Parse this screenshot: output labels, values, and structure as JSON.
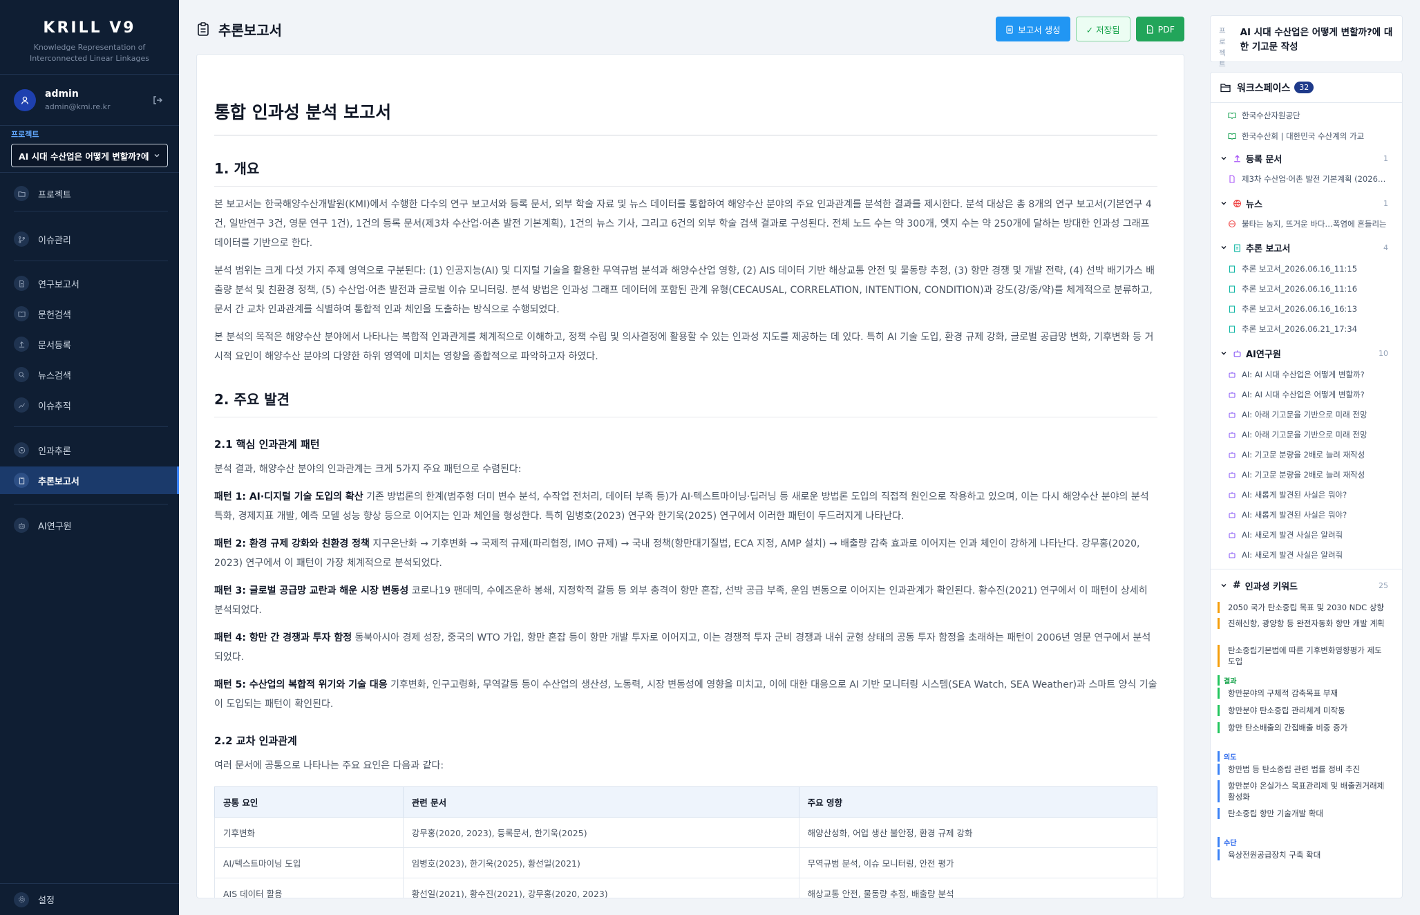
{
  "app": {
    "title": "KRILL V9",
    "subtitle_line1": "Knowledge Representation of",
    "subtitle_line2": "Interconnected Linear Linkages"
  },
  "user": {
    "name": "admin",
    "email": "admin@kmi.re.kr"
  },
  "project": {
    "label": "프로젝트",
    "selected": "AI 시대 수산업은 어떻게 변할까?에"
  },
  "nav": {
    "project": "프로젝트",
    "issues": "이슈관리",
    "reports": "연구보고서",
    "literature": "문헌검색",
    "register": "문서등록",
    "news": "뉴스검색",
    "tracking": "이슈추적",
    "inference": "인과추론",
    "inference_report": "추론보고서",
    "ai_research": "AI연구원",
    "settings": "설정"
  },
  "header": {
    "title": "추론보고서",
    "generate": "보고서 생성",
    "saved": "✓ 저장됨",
    "pdf": "PDF"
  },
  "doc": {
    "title": "통합 인과성 분석 보고서",
    "s1": "1. 개요",
    "p1": "본 보고서는 한국해양수산개발원(KMI)에서 수행한 다수의 연구 보고서와 등록 문서, 외부 학술 자료 및 뉴스 데이터를 통합하여 해양수산 분야의 주요 인과관계를 분석한 결과를 제시한다. 분석 대상은 총 8개의 연구 보고서(기본연구 4건, 일반연구 3건, 영문 연구 1건), 1건의 등록 문서(제3차 수산업·어촌 발전 기본계획), 1건의 뉴스 기사, 그리고 6건의 외부 학술 검색 결과로 구성된다. 전체 노드 수는 약 300개, 엣지 수는 약 250개에 달하는 방대한 인과성 그래프 데이터를 기반으로 한다.",
    "p2": "분석 범위는 크게 다섯 가지 주제 영역으로 구분된다: (1) 인공지능(AI) 및 디지털 기술을 활용한 무역규범 분석과 해양수산업 영향, (2) AIS 데이터 기반 해상교통 안전 및 물동량 추정, (3) 항만 경쟁 및 개발 전략, (4) 선박 배기가스 배출량 분석 및 친환경 정책, (5) 수산업·어촌 발전과 글로벌 이슈 모니터링. 분석 방법은 인과성 그래프 데이터에 포함된 관계 유형(CECAUSAL, CORRELATION, INTENTION, CONDITION)과 강도(강/중/약)를 체계적으로 분류하고, 문서 간 교차 인과관계를 식별하여 통합적 인과 체인을 도출하는 방식으로 수행되었다.",
    "p3": "본 분석의 목적은 해양수산 분야에서 나타나는 복합적 인과관계를 체계적으로 이해하고, 정책 수립 및 의사결정에 활용할 수 있는 인과성 지도를 제공하는 데 있다. 특히 AI 기술 도입, 환경 규제 강화, 글로벌 공급망 변화, 기후변화 등 거시적 요인이 해양수산 분야의 다양한 하위 영역에 미치는 영향을 종합적으로 파악하고자 하였다.",
    "s2": "2. 주요 발견",
    "s21": "2.1 핵심 인과관계 패턴",
    "p4": "분석 결과, 해양수산 분야의 인과관계는 크게 5가지 주요 패턴으로 수렴된다:",
    "pat1_b": "패턴 1: AI·디지털 기술 도입의 확산",
    "pat1": " 기존 방법론의 한계(범주형 더미 변수 분석, 수작업 전처리, 데이터 부족 등)가 AI·텍스트마이닝·딥러닝 등 새로운 방법론 도입의 직접적 원인으로 작용하고 있으며, 이는 다시 해양수산 분야의 분석 특화, 경제지표 개발, 예측 모델 성능 향상 등으로 이어지는 인과 체인을 형성한다. 특히 임병호(2023) 연구와 한기욱(2025) 연구에서 이러한 패턴이 두드러지게 나타난다.",
    "pat2_b": "패턴 2: 환경 규제 강화와 친환경 정책",
    "pat2": " 지구온난화 → 기후변화 → 국제적 규제(파리협정, IMO 규제) → 국내 정책(항만대기질법, ECA 지정, AMP 설치) → 배출량 감축 효과로 이어지는 인과 체인이 강하게 나타난다. 강무홍(2020, 2023) 연구에서 이 패턴이 가장 체계적으로 분석되었다.",
    "pat3_b": "패턴 3: 글로벌 공급망 교란과 해운 시장 변동성",
    "pat3": " 코로나19 팬데믹, 수에즈운하 봉쇄, 지정학적 갈등 등 외부 충격이 항만 혼잡, 선박 공급 부족, 운임 변동으로 이어지는 인과관계가 확인된다. 황수진(2021) 연구에서 이 패턴이 상세히 분석되었다.",
    "pat4_b": "패턴 4: 항만 간 경쟁과 투자 함정",
    "pat4": " 동북아시아 경제 성장, 중국의 WTO 가입, 항만 혼잡 등이 항만 개발 투자로 이어지고, 이는 경쟁적 투자 군비 경쟁과 내쉬 균형 상태의 공동 투자 함정을 초래하는 패턴이 2006년 영문 연구에서 분석되었다.",
    "pat5_b": "패턴 5: 수산업의 복합적 위기와 기술 대응",
    "pat5": " 기후변화, 인구고령화, 무역갈등 등이 수산업의 생산성, 노동력, 시장 변동성에 영향을 미치고, 이에 대한 대응으로 AI 기반 모니터링 시스템(SEA Watch, SEA Weather)과 스마트 양식 기술이 도입되는 패턴이 확인된다.",
    "s22": "2.2 교차 인과관계",
    "p5": "여러 문서에 공통으로 나타나는 주요 요인은 다음과 같다:",
    "table": {
      "headers": [
        "공통 요인",
        "관련 문서",
        "주요 영향"
      ],
      "rows": [
        [
          "기후변화",
          "강무홍(2020, 2023), 등록문서, 한기욱(2025)",
          "해양산성화, 어업 생산 불안정, 환경 규제 강화"
        ],
        [
          "AI/텍스트마이닝 도입",
          "임병호(2023), 한기욱(2025), 황선일(2021)",
          "무역규범 분석, 이슈 모니터링, 안전 평가"
        ],
        [
          "AIS 데이터 활용",
          "황선일(2021), 황수진(2021), 강무홍(2020, 2023)",
          "해상교통 안전, 물동량 추정, 배출량 분석"
        ]
      ]
    }
  },
  "context": {
    "label": "프로젝트",
    "title": "AI 시대 수산업은 어떻게 변할까?에 대한 기고문 작성"
  },
  "workspace": {
    "title": "워크스페이스",
    "count": "32",
    "top_items": [
      "한국수산자원공단",
      "한국수산회 | 대한민국 수산계의 가교"
    ],
    "groups": {
      "registered": {
        "label": "등록 문서",
        "count": "1",
        "items": [
          "제3차 수산업·어촌 발전 기본계획 (2026~2030)"
        ]
      },
      "news": {
        "label": "뉴스",
        "count": "1",
        "items": [
          "불타는 농지, 뜨거운 바다…폭염에 흔들리는"
        ]
      },
      "reports": {
        "label": "추론 보고서",
        "count": "4",
        "items": [
          "추론 보고서_2026.06.16_11:15",
          "추론 보고서_2026.06.16_11:16",
          "추론 보고서_2026.06.16_16:13",
          "추론 보고서_2026.06.21_17:34"
        ]
      },
      "ai": {
        "label": "AI연구원",
        "count": "10",
        "items": [
          "AI: AI 시대 수산업은 어떻게 변할까?",
          "AI: AI 시대 수산업은 어떻게 변할까?",
          "AI: 아래 기고문을 기반으로 미래 전망",
          "AI: 아래 기고문을 기반으로 미래 전망",
          "AI: 기고문 분량을 2배로 늘려 재작성",
          "AI: 기고문 분량을 2배로 늘려 재작성",
          "AI: 새롭게 발견된 사실은 뭐야?",
          "AI: 새롭게 발견된 사실은 뭐야?",
          "AI: 새로게 발견 사실은 알려줘",
          "AI: 새로게 발견 사실은 알려줘"
        ]
      }
    }
  },
  "keywords": {
    "title": "인과성 키워드",
    "count": "25",
    "cause": [
      "2050 국가 탄소중립 목표 및 2030 NDC 상향",
      "진해신항, 광양항 등 완전자동화 항만 개발 계획",
      "탄소중립기본법에 따른 기후변화영향평가 제도 도입"
    ],
    "effect_label": "결과",
    "effect": [
      "항만분야의 구체적 감축목표 부재",
      "항만분야 탄소중립 관리체계 미작동",
      "항만 탄소배출의 간접배출 비중 증가"
    ],
    "intent_label": "의도",
    "intent": [
      "항만법 등 탄소중립 관련 법률 정비 추진",
      "항만분야 온실가스 목표관리제 및 배출권거래제 활성화",
      "탄소중립 항만 기술개발 확대"
    ],
    "means_label": "수단",
    "means": [
      "육상전원공급장치 구축 확대"
    ]
  }
}
